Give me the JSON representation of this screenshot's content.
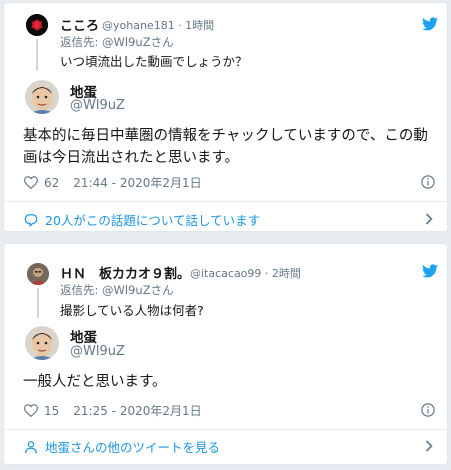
{
  "card1": {
    "reply": {
      "name": "こころ",
      "handle": "@yohane181 · 1時間",
      "reply_to": "返信先: @Wl9uZさん",
      "text": "いつ頃流出した動画でしょうか？"
    },
    "author": {
      "name": "地蛋",
      "handle": "@Wl9uZ"
    },
    "text": "基本的に毎日中華圏の情報をチャックしていますので、この動画は今日流出されたと思います。",
    "likes": "62",
    "timestamp": "21:44 - 2020年2月1日",
    "footer": "20人がこの話題について話しています"
  },
  "card2": {
    "reply": {
      "name": "ＨＮ　板カカオ９割。",
      "handle": "@itacacao99 · 2時間",
      "reply_to": "返信先: @Wl9uZさん",
      "text": "撮影している人物は何者?"
    },
    "author": {
      "name": "地蛋",
      "handle": "@Wl9uZ"
    },
    "text": "一般人だと思います。",
    "likes": "15",
    "timestamp": "21:25 - 2020年2月1日",
    "footer": "地蛋さんの他のツイートを見る"
  },
  "colors": {
    "link": "#1b95e0",
    "twitter_blue": "#1da1f2",
    "muted": "#657786",
    "background": "#e6ecf0"
  },
  "icons": [
    "twitter-bird-icon",
    "heart-icon",
    "info-icon",
    "comment-icon",
    "person-icon",
    "chevron-right-icon"
  ]
}
